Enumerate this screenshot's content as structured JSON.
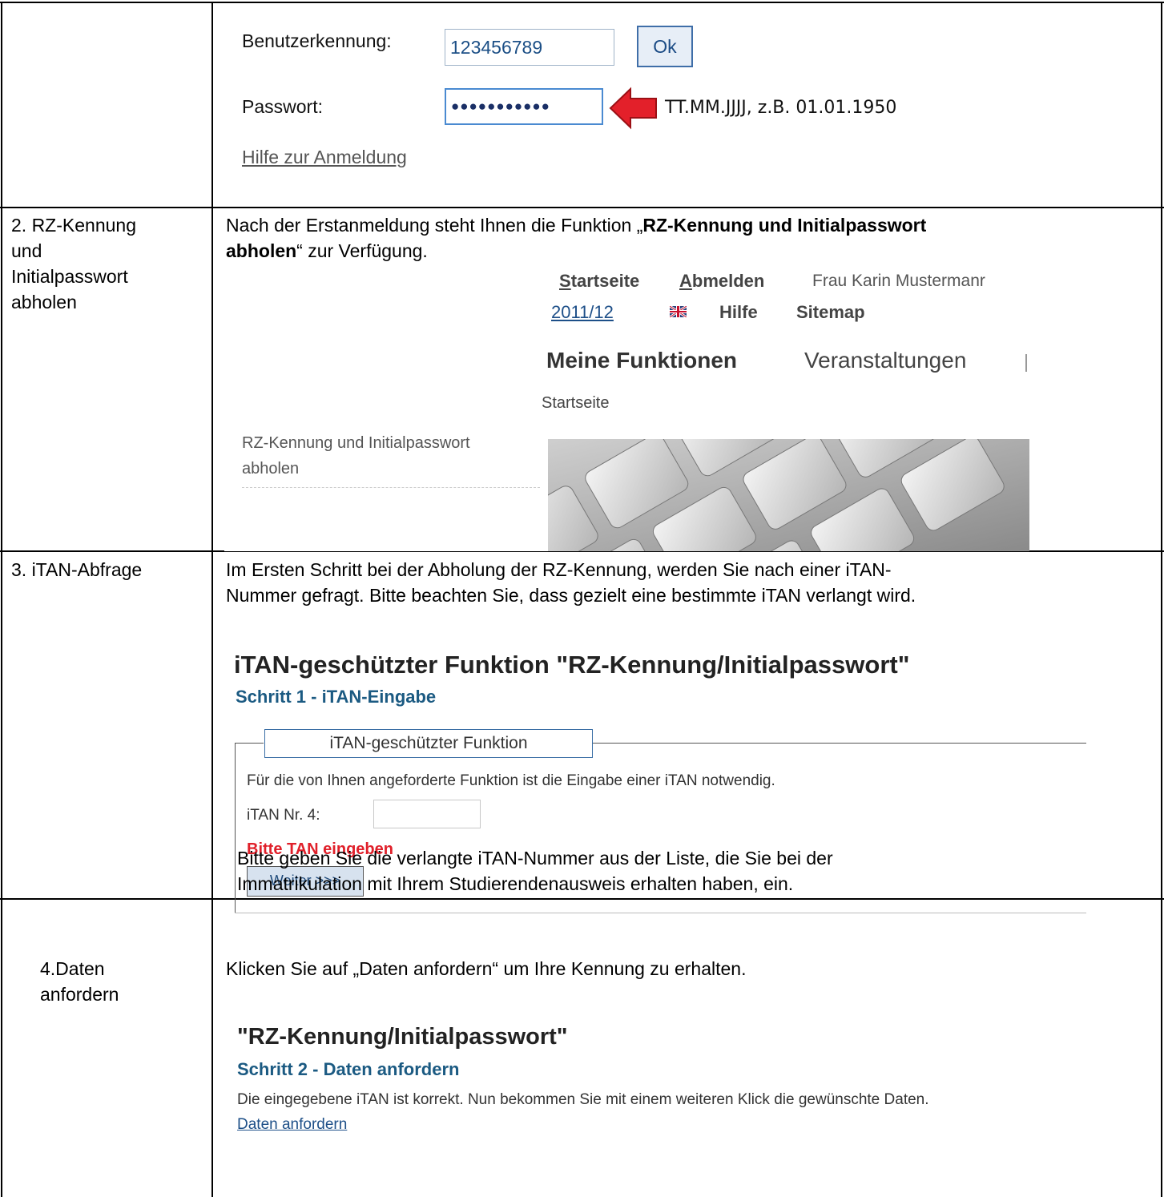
{
  "row1": {
    "user_label": "Benutzerkennung:",
    "user_value": "123456789",
    "ok_label": "Ok",
    "password_label": "Passwort:",
    "password_value": "●●●●●●●●●●●",
    "hint": "TT.MM.JJJJ, z.B. 01.01.1950",
    "help_link": "Hilfe zur Anmeldung"
  },
  "row2": {
    "step": [
      "2. RZ-Kennung",
      "und",
      "Initialpasswort",
      "abholen"
    ],
    "intro_pre": "Nach der Erstanmeldung steht Ihnen die Funktion „",
    "intro_bold_1": "RZ-Kennung und Initialpasswort",
    "intro_bold_2": "abholen",
    "intro_post": "“ zur Verfügung.",
    "nav_startseite": "Startseite",
    "nav_abmelden": "Abmelden",
    "nav_user": "Frau Karin Mustermanr",
    "nav_year": "2011/12",
    "nav_hilfe": "Hilfe",
    "nav_sitemap": "Sitemap",
    "tab_main": "Meine Funktionen",
    "tab_other": "Veranstaltungen",
    "breadcrumb": "Startseite",
    "side_link_1": "RZ-Kennung und Initialpasswort",
    "side_link_2": "abholen"
  },
  "row3": {
    "step": "3. iTAN-Abfrage",
    "intro_1": "Im Ersten Schritt bei der Abholung der RZ-Kennung, werden Sie nach einer iTAN-",
    "intro_2": "Nummer gefragt. Bitte beachten Sie, dass gezielt eine bestimmte iTAN verlangt wird.",
    "heading": "iTAN-geschützter Funktion \"RZ-Kennung/Initialpasswort\"",
    "subheading": "Schritt 1 - iTAN-Eingabe",
    "legend": "iTAN-geschützter Funktion",
    "notice": "Für die von Ihnen angeforderte Funktion ist die Eingabe einer iTAN notwendig.",
    "tan_label": "iTAN Nr. 4:",
    "error": "Bitte TAN eingeben",
    "weiter": "Weiter >>>",
    "outro_1": "Bitte geben Sie die verlangte iTAN-Nummer aus der Liste, die Sie bei der",
    "outro_2": "Immatrikulation mit Ihrem Studierendenausweis erhalten haben, ein."
  },
  "row4": {
    "step_1": "4.Daten",
    "step_2": "anfordern",
    "intro": "Klicken Sie auf „Daten anfordern“ um Ihre Kennung zu erhalten.",
    "heading": "\"RZ-Kennung/Initialpasswort\"",
    "subheading": "Schritt 2 - Daten anfordern",
    "notice": "Die eingegebene iTAN ist korrekt. Nun bekommen Sie mit einem weiteren Klick die gewünschte Daten.",
    "link": "Daten anfordern"
  },
  "colors": {
    "arrow": "#e3202a",
    "error": "#e0202a",
    "subheading": "#1b5a82",
    "link": "#1d4f88"
  }
}
